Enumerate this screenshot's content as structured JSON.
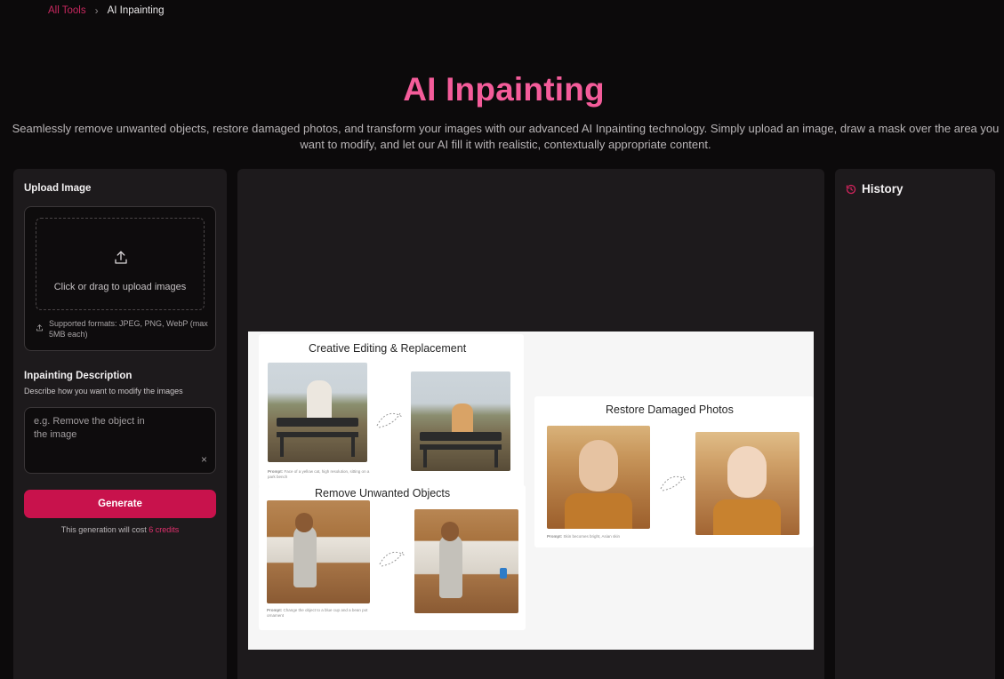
{
  "breadcrumb": {
    "link": "All Tools",
    "separator": "›",
    "current": "AI Inpainting"
  },
  "header": {
    "title": "AI Inpainting",
    "subtitle": "Seamlessly remove unwanted objects, restore damaged photos, and transform your images with our advanced AI Inpainting technology. Simply upload an image, draw a mask over the area you want to modify, and let our AI fill it with realistic, contextually appropriate content."
  },
  "upload": {
    "title": "Upload Image",
    "drop_text": "Click or drag to upload images",
    "formats": "Supported formats: JPEG, PNG, WebP (max 5MB each)"
  },
  "description": {
    "title": "Inpainting Description",
    "hint": "Describe how you want to modify the images",
    "placeholder": "e.g. Remove the object in the image",
    "clear": "×"
  },
  "generate": {
    "label": "Generate",
    "cost_prefix": "This generation will cost",
    "cost_credits": "6 credits"
  },
  "history": {
    "title": "History"
  },
  "preview": {
    "creative_title": "Creative Editing & Replacement",
    "creative_prompt_label": "Prompt:",
    "creative_prompt": "Face of a yellow cat, high resolution, sitting on a park bench",
    "remove_title": "Remove Unwanted Objects",
    "remove_prompt_label": "Prompt:",
    "remove_prompt": "Change the object to a blue cup and a bean pot ornament",
    "restore_title": "Restore Damaged Photos",
    "restore_prompt_label": "Prompt:",
    "restore_prompt": "Skin becomes bright, Asian skin"
  },
  "colors": {
    "accent": "#c8124c",
    "title_pink": "#f45c9a",
    "background": "#0c0a0b",
    "panel": "#1d1a1c"
  }
}
